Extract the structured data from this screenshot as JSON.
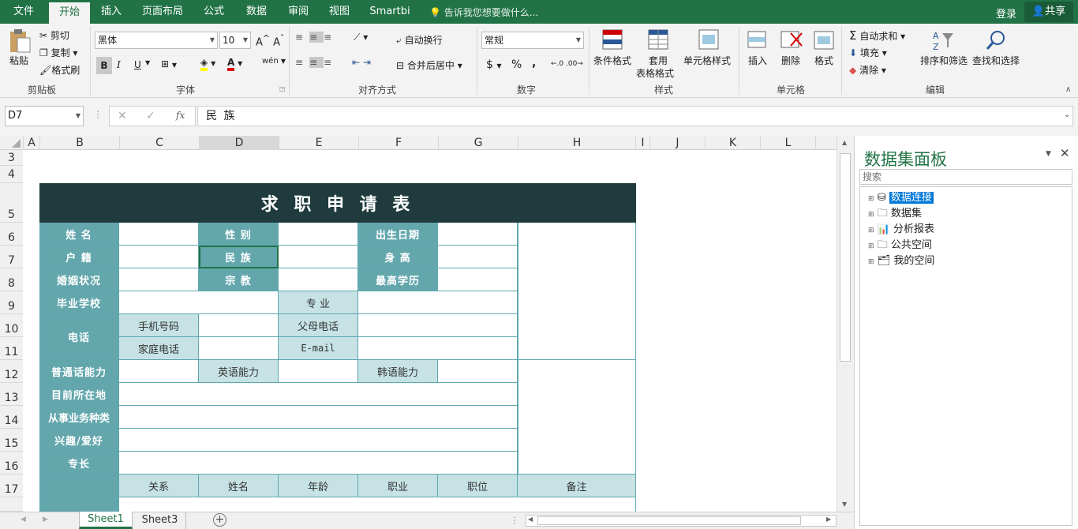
{
  "ribbon_tabs": [
    "文件",
    "开始",
    "插入",
    "页面布局",
    "公式",
    "数据",
    "审阅",
    "视图",
    "Smartbi"
  ],
  "tell_me": "告诉我您想要做什么...",
  "login": "登录",
  "share": "共享",
  "clipboard": {
    "paste": "粘贴",
    "cut": "剪切",
    "copy": "复制",
    "format_painter": "格式刷",
    "group": "剪贴板"
  },
  "font": {
    "name": "黑体",
    "size": "10",
    "group": "字体",
    "bold": "B",
    "italic": "I",
    "underline": "U"
  },
  "alignment": {
    "wrap": "自动换行",
    "merge": "合并后居中",
    "group": "对齐方式"
  },
  "number": {
    "format": "常规",
    "group": "数字",
    "currency": "$",
    "percent": "%",
    "comma": ","
  },
  "styles": {
    "conditional": "条件格式",
    "table1": "套用",
    "table2": "表格格式",
    "cell_style": "单元格样式",
    "group": "样式"
  },
  "cells": {
    "insert": "插入",
    "delete": "删除",
    "format": "格式",
    "group": "单元格"
  },
  "editing": {
    "autosum": "自动求和",
    "fill": "填充",
    "clear": "清除",
    "sort": "排序和筛选",
    "find": "查找和选择",
    "group": "编辑"
  },
  "formula_bar": {
    "name_box": "D7",
    "fx": "fx",
    "content": "民 族"
  },
  "columns": [
    "A",
    "B",
    "C",
    "D",
    "E",
    "F",
    "G",
    "H",
    "I",
    "J",
    "K",
    "L"
  ],
  "rows": [
    "3",
    "4",
    "5",
    "6",
    "7",
    "8",
    "9",
    "10",
    "11",
    "12",
    "13",
    "14",
    "15",
    "16",
    "17"
  ],
  "form": {
    "title": "求 职 申 请 表",
    "name": "姓 名",
    "gender": "性 别",
    "birth": "出生日期",
    "hukou": "户 籍",
    "ethnicity": "民 族",
    "height": "身 高",
    "marital": "婚姻状况",
    "religion": "宗 教",
    "education": "最高学历",
    "school": "毕业学校",
    "major": "专 业",
    "phone": "电话",
    "mobile": "手机号码",
    "parent_phone": "父母电话",
    "home_phone": "家庭电话",
    "email": "E-mail",
    "mandarin": "普通话能力",
    "english": "英语能力",
    "korean": "韩语能力",
    "location": "目前所在地",
    "industry": "从事业务种类",
    "hobby": "兴趣/爱好",
    "skill": "专长",
    "rel": "关系",
    "fname": "姓名",
    "age": "年龄",
    "job": "职业",
    "position": "职位",
    "note": "备注"
  },
  "panel": {
    "title": "数据集面板",
    "search_placeholder": "搜索",
    "tree": [
      "数据连接",
      "数据集",
      "分析报表",
      "公共空间",
      "我的空间"
    ]
  },
  "sheets": [
    "Sheet1",
    "Sheet3"
  ],
  "colors": {
    "accent": "#217346",
    "header": "#1f3b3d",
    "label": "#63a7ad",
    "light": "#c6e2e4"
  }
}
